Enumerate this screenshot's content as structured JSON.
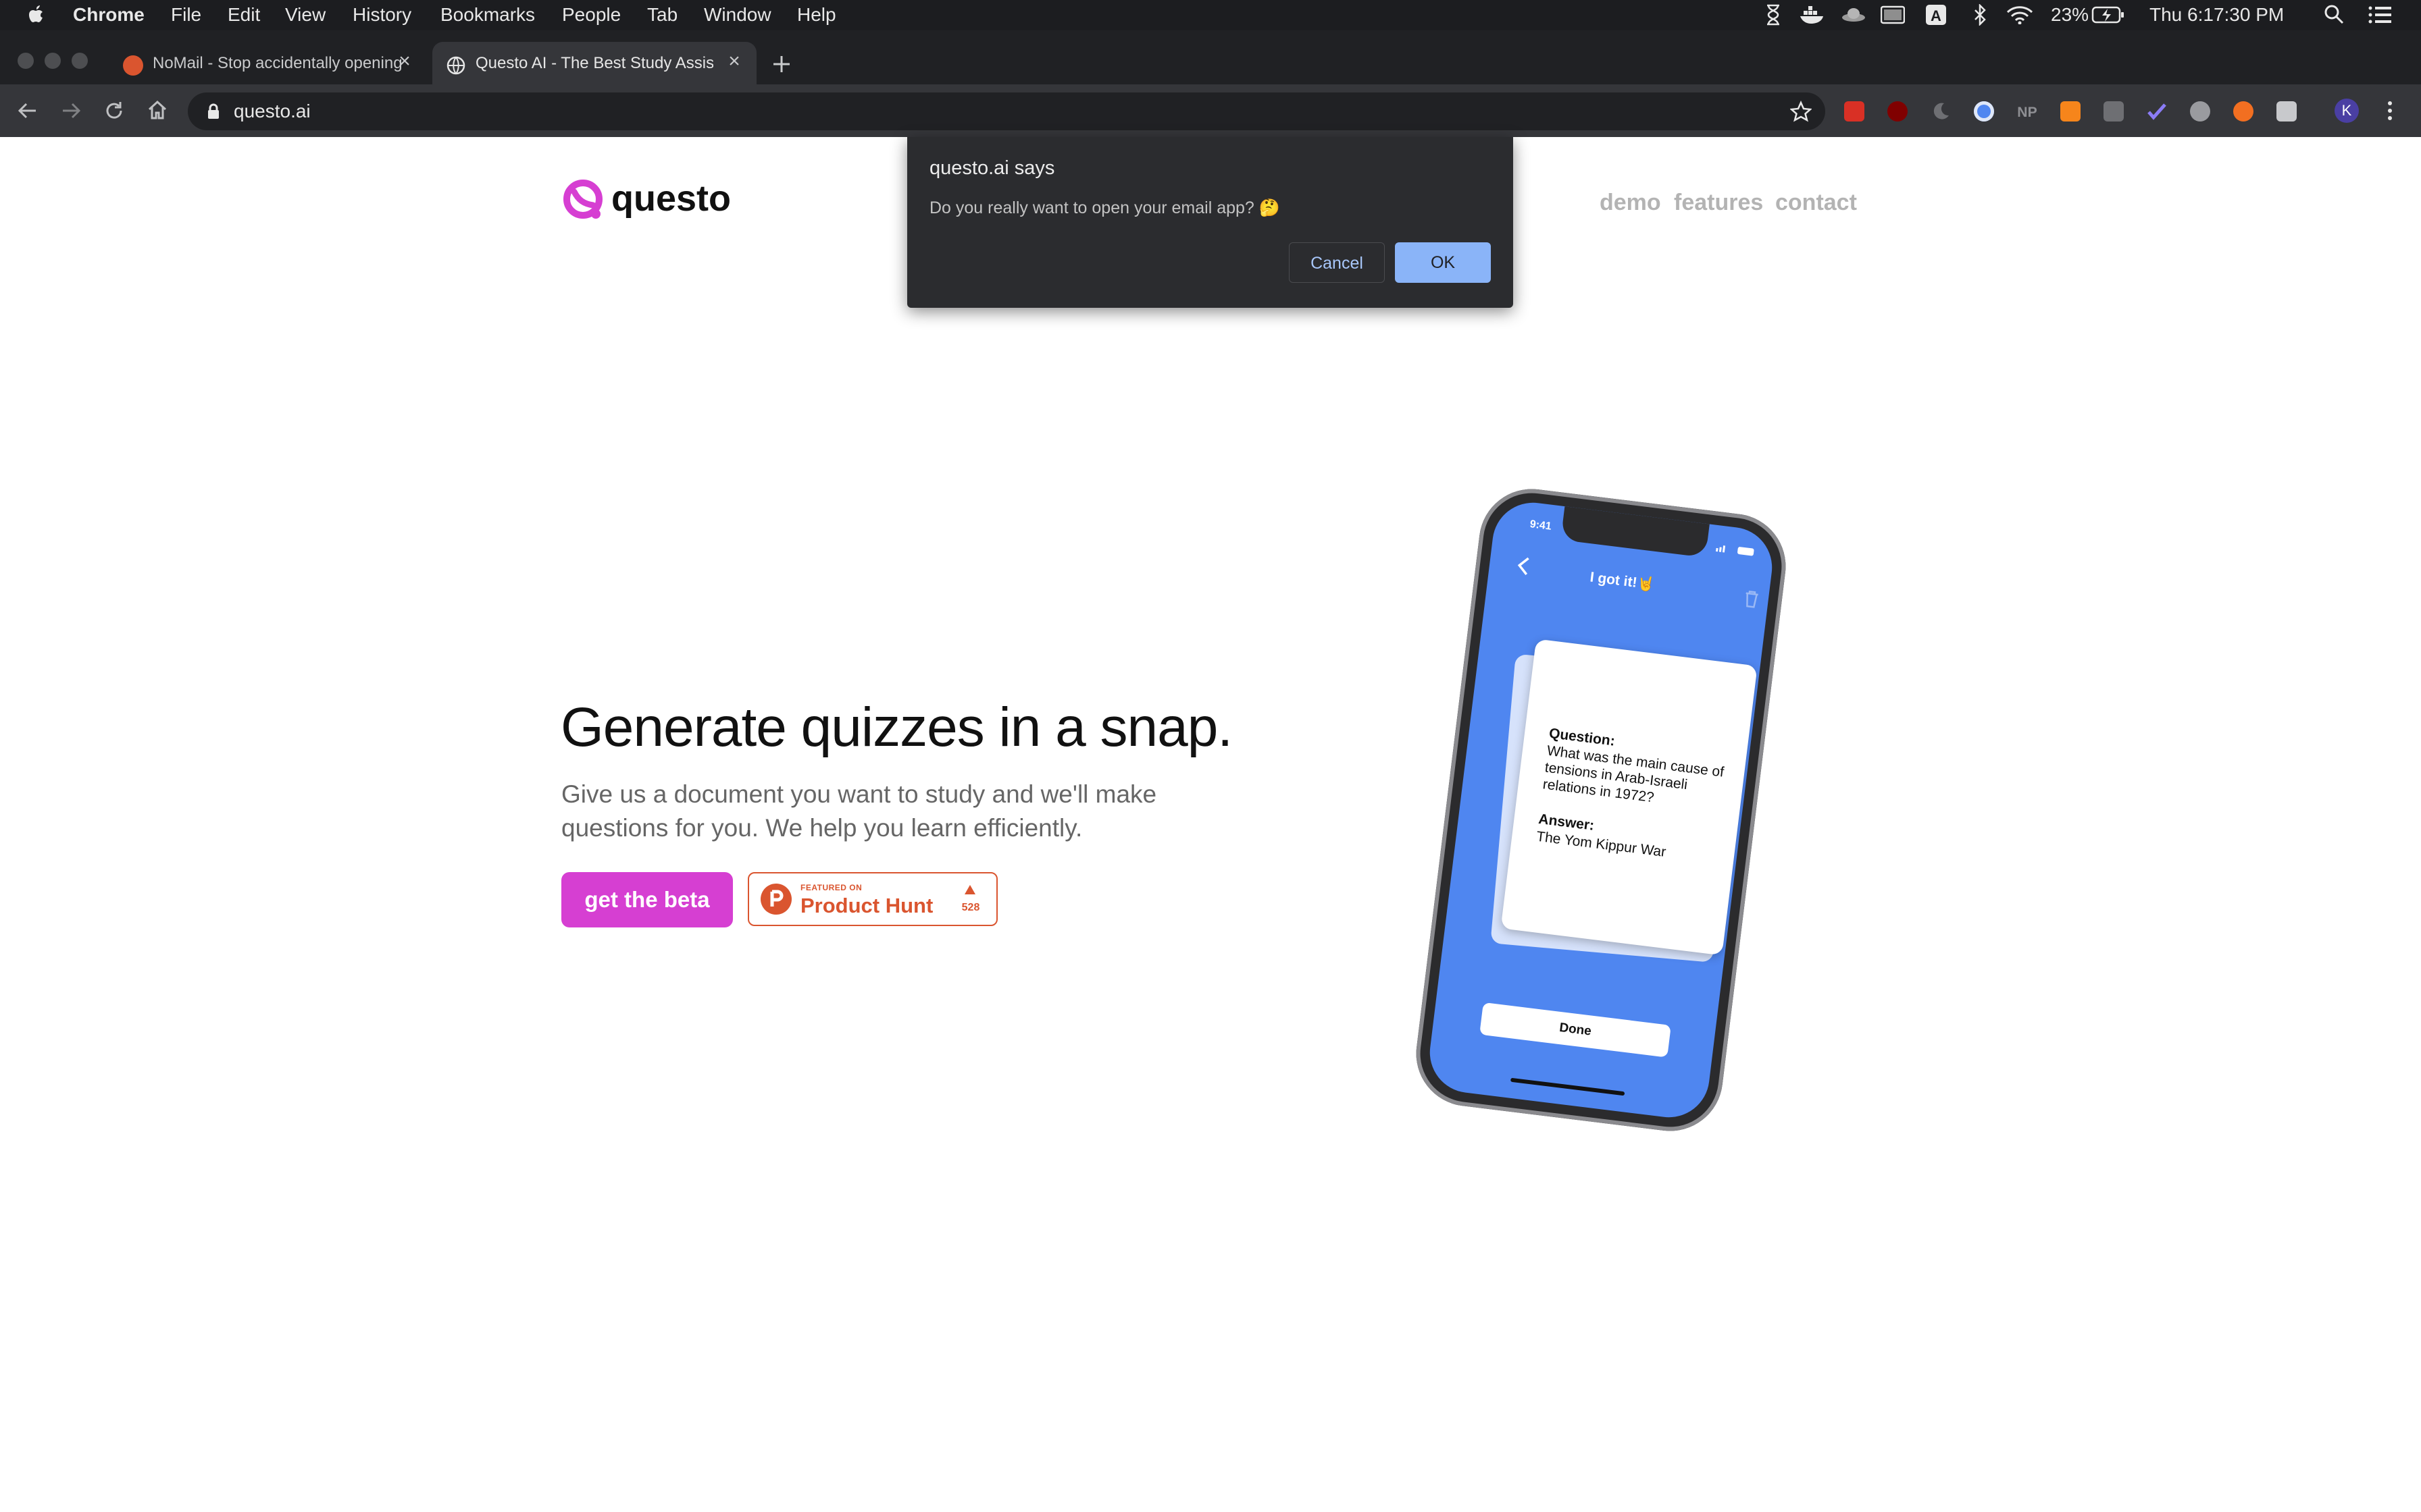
{
  "menubar": {
    "app": "Chrome",
    "menus": [
      "File",
      "Edit",
      "View",
      "History",
      "Bookmarks",
      "People",
      "Tab",
      "Window",
      "Help"
    ],
    "battery": "23%",
    "clock": "Thu 6:17:30 PM"
  },
  "tabs": [
    {
      "title": "NoMail - Stop accidentally opening",
      "favicon": "product-hunt-icon",
      "active": false
    },
    {
      "title": "Questo AI - The Best Study Assistant",
      "favicon": "globe-icon",
      "active": true
    }
  ],
  "toolbar": {
    "url": "questo.ai",
    "profile_initial": "K"
  },
  "site": {
    "logo": "questo",
    "nav": [
      "demo",
      "features",
      "contact"
    ],
    "hero_title": "Generate quizzes in a snap.",
    "hero_subtitle": "Give us a document you want to study and we'll make questions for you. We help you learn efficiently.",
    "cta": "get the beta",
    "product_hunt": {
      "featured": "FEATURED ON",
      "name": "Product Hunt",
      "votes": "528"
    },
    "colors": {
      "brand": "#d63fd2",
      "ph": "#da552f",
      "app_blue": "#4f86f0"
    }
  },
  "phone": {
    "time": "9:41",
    "header": "I got it!🤘",
    "question_label": "Question:",
    "question": "What was the main cause of tensions in Arab-Israeli relations in 1972?",
    "answer_label": "Answer:",
    "answer": "The Yom Kippur War",
    "done": "Done"
  },
  "dialog": {
    "title": "questo.ai says",
    "message": "Do you really want to open your email app? 🤔",
    "cancel": "Cancel",
    "ok": "OK"
  }
}
